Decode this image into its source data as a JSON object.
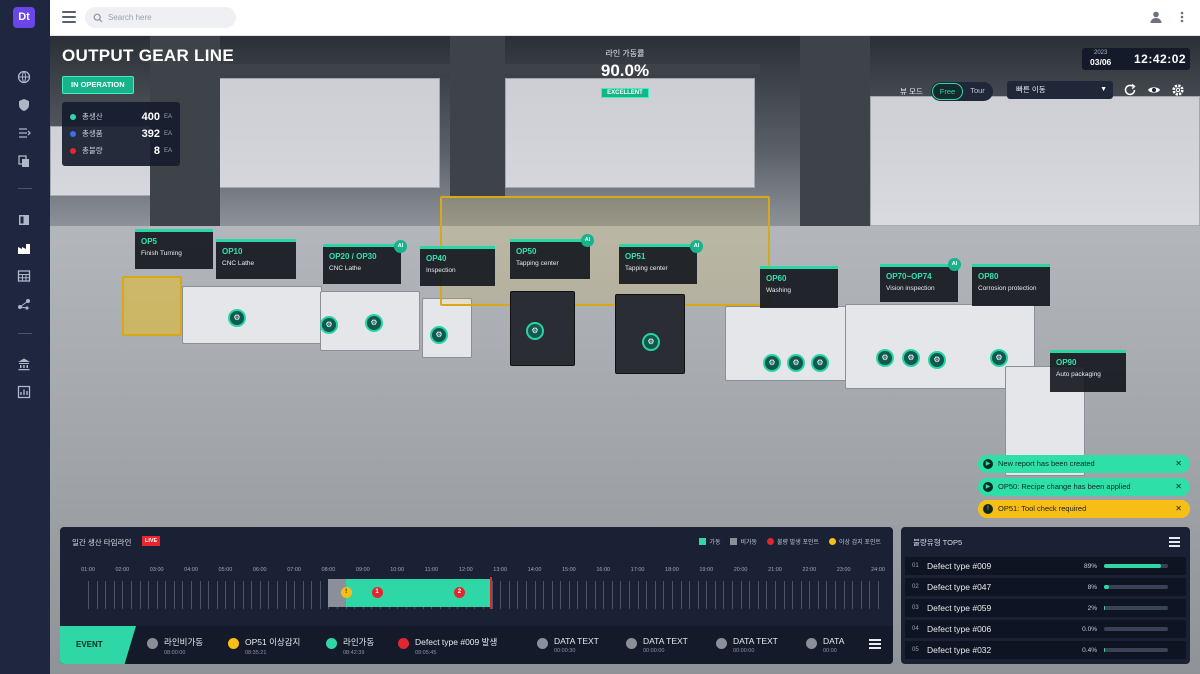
{
  "app": {
    "logo": "Dt",
    "search_placeholder": "Search here",
    "sidebar_icons": [
      "globe-icon",
      "shield-icon",
      "queue-icon",
      "copy-icon",
      "layout-icon",
      "factory-icon",
      "table-icon",
      "network-icon",
      "bank-icon",
      "chart-icon"
    ]
  },
  "header": {
    "title": "OUTPUT GEAR LINE",
    "status": "IN OPERATION",
    "stats": [
      {
        "label": "총생산",
        "value": "400",
        "unit": "EA",
        "color": "#2ed7a5"
      },
      {
        "label": "총생품",
        "value": "392",
        "unit": "EA",
        "color": "#3b6ee8"
      },
      {
        "label": "총불량",
        "value": "8",
        "unit": "EA",
        "color": "#e0272f"
      }
    ],
    "rate_label": "라인 가동률",
    "rate_value": "90.0%",
    "rate_badge": "EXCELLENT",
    "clock_year": "2023",
    "clock_date": "03/06",
    "clock_time": "12:42:02",
    "view_label": "뷰 모드",
    "view_modes": [
      "Free",
      "Tour"
    ],
    "quick_move": "빠른 이동"
  },
  "stations": [
    {
      "op": "OP5",
      "name": "Finish Turning",
      "ai": false
    },
    {
      "op": "OP10",
      "name": "CNC Lathe",
      "ai": false
    },
    {
      "op": "OP20 / OP30",
      "name": "CNC Lathe",
      "ai": true
    },
    {
      "op": "OP40",
      "name": "Inspection",
      "ai": false
    },
    {
      "op": "OP50",
      "name": "Tapping center",
      "ai": true
    },
    {
      "op": "OP51",
      "name": "Tapping center",
      "ai": true
    },
    {
      "op": "OP60",
      "name": "Washing",
      "ai": false
    },
    {
      "op": "OP70~OP74",
      "name": "Vision inspection",
      "ai": true
    },
    {
      "op": "OP80",
      "name": "Corrosion protection",
      "ai": false
    },
    {
      "op": "OP90",
      "name": "Auto packaging",
      "ai": false
    }
  ],
  "notifications": [
    {
      "text": "New report has been created",
      "type": "green"
    },
    {
      "text": "OP50: Recipe change has been applied",
      "type": "green"
    },
    {
      "text": "OP51: Tool check required",
      "type": "yellow"
    }
  ],
  "timeline": {
    "title": "일간 생산 타임라인",
    "live": "LIVE",
    "legend": [
      {
        "label": "가동",
        "color": "#2ed7a5",
        "shape": "square"
      },
      {
        "label": "비가동",
        "color": "#8a8f99",
        "shape": "square"
      },
      {
        "label": "불량 발생 포인트",
        "color": "#e0272f",
        "shape": "round"
      },
      {
        "label": "이상 감지 포인트",
        "color": "#f7bf16",
        "shape": "round"
      }
    ],
    "hours": [
      "01:00",
      "02:00",
      "03:00",
      "04:00",
      "05:00",
      "06:00",
      "07:00",
      "08:00",
      "09:00",
      "10:00",
      "11:00",
      "12:00",
      "13:00",
      "14:00",
      "15:00",
      "16:00",
      "17:00",
      "18:00",
      "19:00",
      "20:00",
      "21:00",
      "22:00",
      "23:00",
      "24:00"
    ],
    "idle_segments": [
      [
        8.0,
        8.5
      ]
    ],
    "run_segments": [
      [
        8.5,
        12.7
      ]
    ],
    "markers": [
      {
        "hour": 8.5,
        "label": "!",
        "type": "yellow"
      },
      {
        "hour": 9.4,
        "label": "1",
        "type": "red"
      },
      {
        "hour": 11.8,
        "label": "2",
        "type": "red"
      }
    ],
    "now": 12.7
  },
  "events": {
    "tag": "EVENT",
    "items": [
      {
        "title": "라인비가동",
        "time": "08:00:00",
        "color": "#8a8f99"
      },
      {
        "title": "OP51 이상감지",
        "time": "08:35:21",
        "color": "#f7bf16"
      },
      {
        "title": "라인가동",
        "time": "08:42:39",
        "color": "#2ed7a5"
      },
      {
        "title": "Defect type #009 발생",
        "time": "09:05:45",
        "color": "#e0272f"
      },
      {
        "title": "DATA TEXT",
        "time": "00:00:30",
        "color": "#8a8f99"
      },
      {
        "title": "DATA TEXT",
        "time": "00:00:00",
        "color": "#8a8f99"
      },
      {
        "title": "DATA TEXT",
        "time": "00:00:00",
        "color": "#8a8f99"
      },
      {
        "title": "DATA",
        "time": "00:00",
        "color": "#8a8f99"
      }
    ]
  },
  "defects": {
    "title": "불량유형 TOP5",
    "rows": [
      {
        "rank": "01",
        "name": "Defect type #009",
        "pct": "89%",
        "value": 0.89
      },
      {
        "rank": "02",
        "name": "Defect type #047",
        "pct": "8%",
        "value": 0.08
      },
      {
        "rank": "03",
        "name": "Defect type #059",
        "pct": "2%",
        "value": 0.02
      },
      {
        "rank": "04",
        "name": "Defect type #006",
        "pct": "0.0%",
        "value": 0.0
      },
      {
        "rank": "05",
        "name": "Defect type #032",
        "pct": "0.4%",
        "value": 0.004
      }
    ]
  }
}
